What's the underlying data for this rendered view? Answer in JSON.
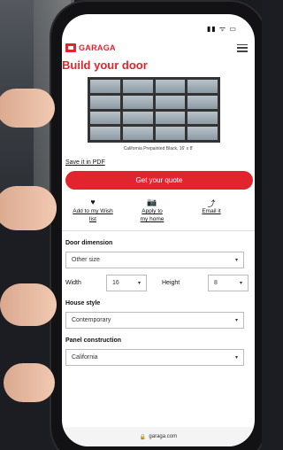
{
  "status": {
    "time": "",
    "indicators": "▮▮ ᯤ ▭"
  },
  "header": {
    "brand": "GARAGA",
    "menu_icon": "hamburger-menu-icon"
  },
  "page": {
    "title": "Build your door"
  },
  "door_preview": {
    "caption": "California Prepainted Black, 16' x 8'",
    "panel_color": "#9aa6ae",
    "frame_color": "#333333"
  },
  "links": {
    "save_pdf": "Save it in PDF"
  },
  "cta": {
    "quote_label": "Get your quote",
    "color": "#e2242e"
  },
  "actions": [
    {
      "icon": "heart-icon",
      "label_line1": "Add to my Wish",
      "label_line2": "list"
    },
    {
      "icon": "camera-icon",
      "label_line1": "Apply to",
      "label_line2": "my home"
    },
    {
      "icon": "share-icon",
      "label_line1": "Email it",
      "label_line2": ""
    }
  ],
  "door_dimension": {
    "label": "Door dimension",
    "size_value": "Other size",
    "width_label": "Width",
    "width_value": "16",
    "height_label": "Height",
    "height_value": "8"
  },
  "house_style": {
    "label": "House style",
    "value": "Contemporary"
  },
  "panel_construction": {
    "label": "Panel construction",
    "value": "California"
  },
  "browser": {
    "url": "garaga.com"
  }
}
